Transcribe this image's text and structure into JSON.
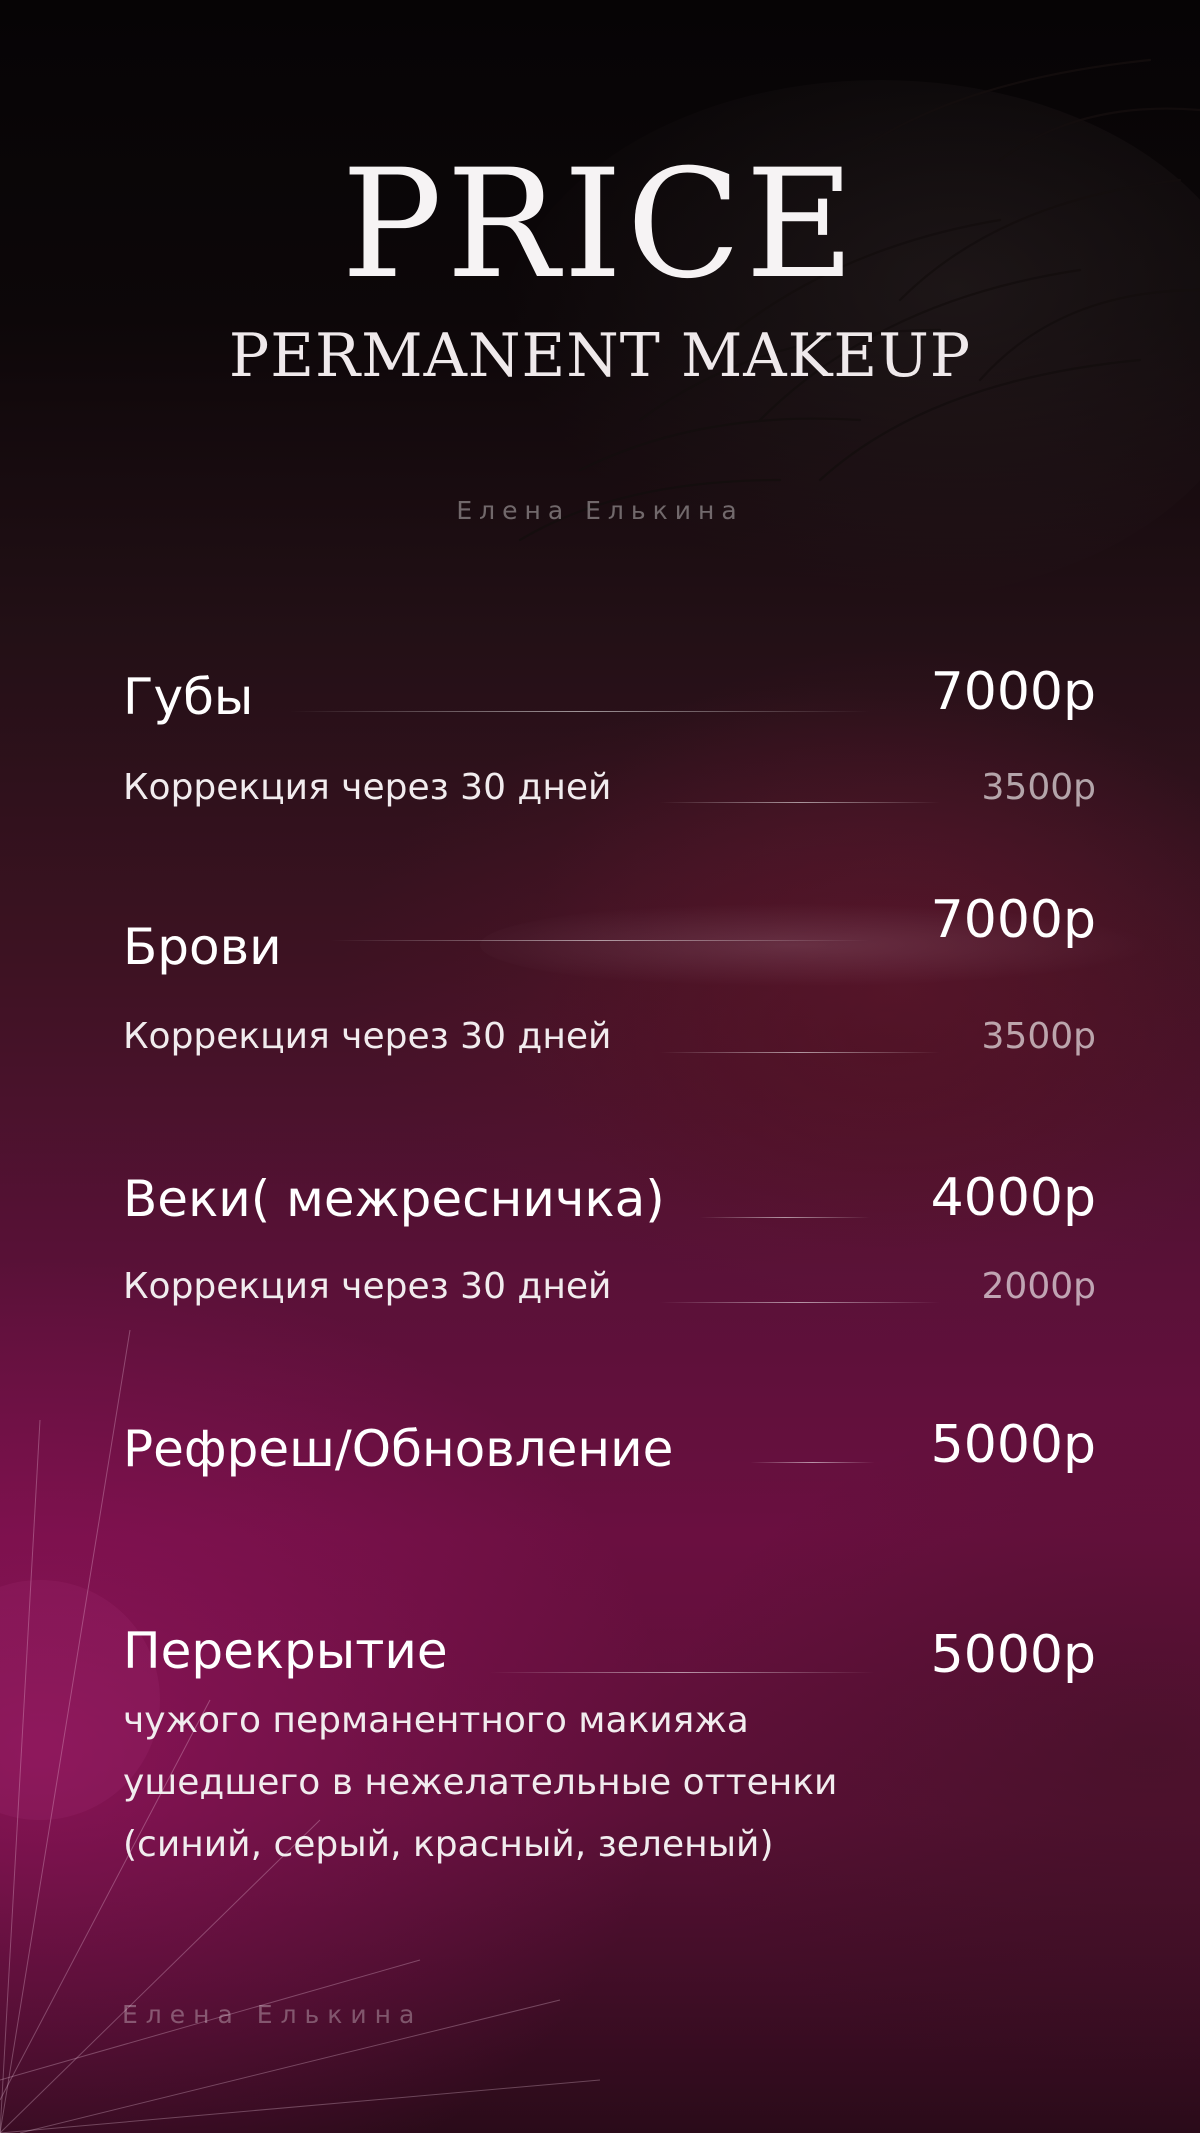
{
  "header": {
    "title": "PRICE",
    "subtitle": "PERMANENT MAKEUP",
    "author": "Елена Елькина"
  },
  "services": [
    {
      "name": "Губы",
      "price": "7000р",
      "correction_label": "Коррекция через 30 дней",
      "correction_price": "3500р"
    },
    {
      "name": "Брови",
      "price": "7000р",
      "correction_label": "Коррекция через 30 дней",
      "correction_price": "3500р"
    },
    {
      "name": "Веки( межресничка)",
      "price": "4000р",
      "correction_label": "Коррекция через 30 дней",
      "correction_price": "2000р"
    },
    {
      "name": "Рефреш/Обновление",
      "price": "5000р"
    },
    {
      "name": "Перекрытие",
      "price": "5000р",
      "description": [
        "чужого перманентного макияжа",
        "ушедшего в нежелательные оттенки",
        "(синий, серый, красный, зеленый)"
      ]
    }
  ],
  "footer": {
    "watermark": "Елена Елькина"
  }
}
